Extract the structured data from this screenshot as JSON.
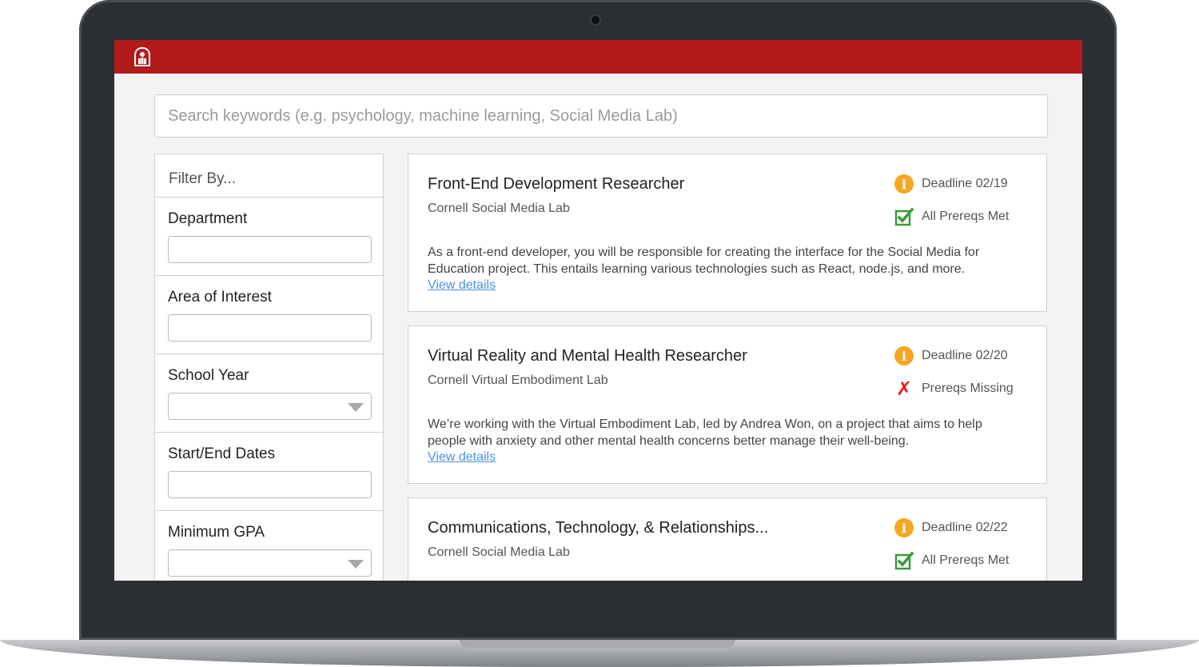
{
  "colors": {
    "brand_red": "#b31b1b",
    "info_orange": "#f5a623",
    "check_green": "#3a9a3a",
    "missing_red": "#e0211b",
    "link_blue": "#4a90e2"
  },
  "header": {
    "logo_icon": "cornell-logo-icon"
  },
  "search": {
    "placeholder": "Search keywords (e.g. psychology, machine learning, Social Media Lab)",
    "value": ""
  },
  "filters": {
    "heading": "Filter By...",
    "department": {
      "label": "Department",
      "value": ""
    },
    "area_of_interest": {
      "label": "Area of Interest",
      "value": ""
    },
    "school_year": {
      "label": "School Year",
      "value": ""
    },
    "start_end_dates": {
      "label": "Start/End Dates",
      "value": ""
    },
    "minimum_gpa": {
      "label": "Minimum GPA",
      "value": ""
    }
  },
  "results": [
    {
      "title": "Front-End Development Researcher",
      "lab": "Cornell Social Media Lab",
      "deadline": "Deadline 02/19",
      "prereq_status": "All Prereqs Met",
      "prereq_icon": "checkbox-checked-icon",
      "description": "As a front-end developer, you will be responsible for creating the interface for the Social Media for Education project. This entails learning various technologies such as React, node.js, and more.",
      "link": "View details"
    },
    {
      "title": "Virtual Reality and Mental Health Researcher",
      "lab": "Cornell Virtual Embodiment Lab",
      "deadline": "Deadline 02/20",
      "prereq_status": "Prereqs Missing",
      "prereq_icon": "x-icon",
      "description": "We’re working with the Virtual Embodiment Lab, led by Andrea Won, on a project that aims to help people with anxiety and other mental health concerns better manage their well-being.",
      "link": "View details"
    },
    {
      "title": "Communications, Technology, & Relationships...",
      "lab": "Cornell Social Media Lab",
      "deadline": "Deadline 02/22",
      "prereq_status": "All Prereqs Met",
      "prereq_icon": "checkbox-checked-icon",
      "description": "",
      "link": ""
    }
  ]
}
